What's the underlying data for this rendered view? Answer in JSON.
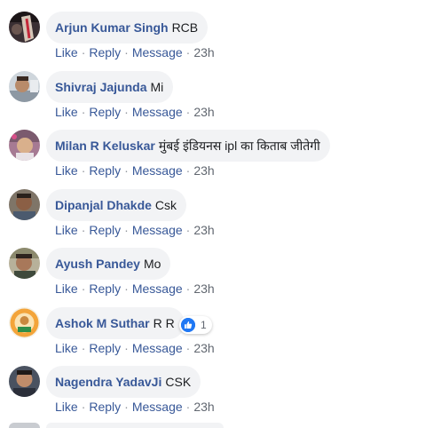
{
  "actions": {
    "like": "Like",
    "reply": "Reply",
    "message": "Message",
    "separator": "·"
  },
  "comments": [
    {
      "author": "Arjun Kumar Singh",
      "text": "RCB",
      "time": "23h"
    },
    {
      "author": "Shivraj Jajunda",
      "text": "Mi",
      "time": "23h"
    },
    {
      "author": "Milan R Keluskar",
      "text": "मुंबई इंडियनस ipl का किताब जीतेगी",
      "time": "23h"
    },
    {
      "author": "Dipanjal Dhakde",
      "text": "Csk",
      "time": "23h"
    },
    {
      "author": "Ayush Pandey",
      "text": "Mo",
      "time": "23h"
    },
    {
      "author": "Ashok M Suthar",
      "text": "R R",
      "time": "23h",
      "reaction_count": "1",
      "reaction_icon": "like-icon"
    },
    {
      "author": "Nagendra YadavJi",
      "text": "CSK",
      "time": "23h"
    }
  ],
  "colors": {
    "author": "#385898",
    "bubble": "#f2f3f5",
    "text": "#1c1e21",
    "action": "#385898",
    "meta": "#616770",
    "like_blue": "#2078f4"
  }
}
